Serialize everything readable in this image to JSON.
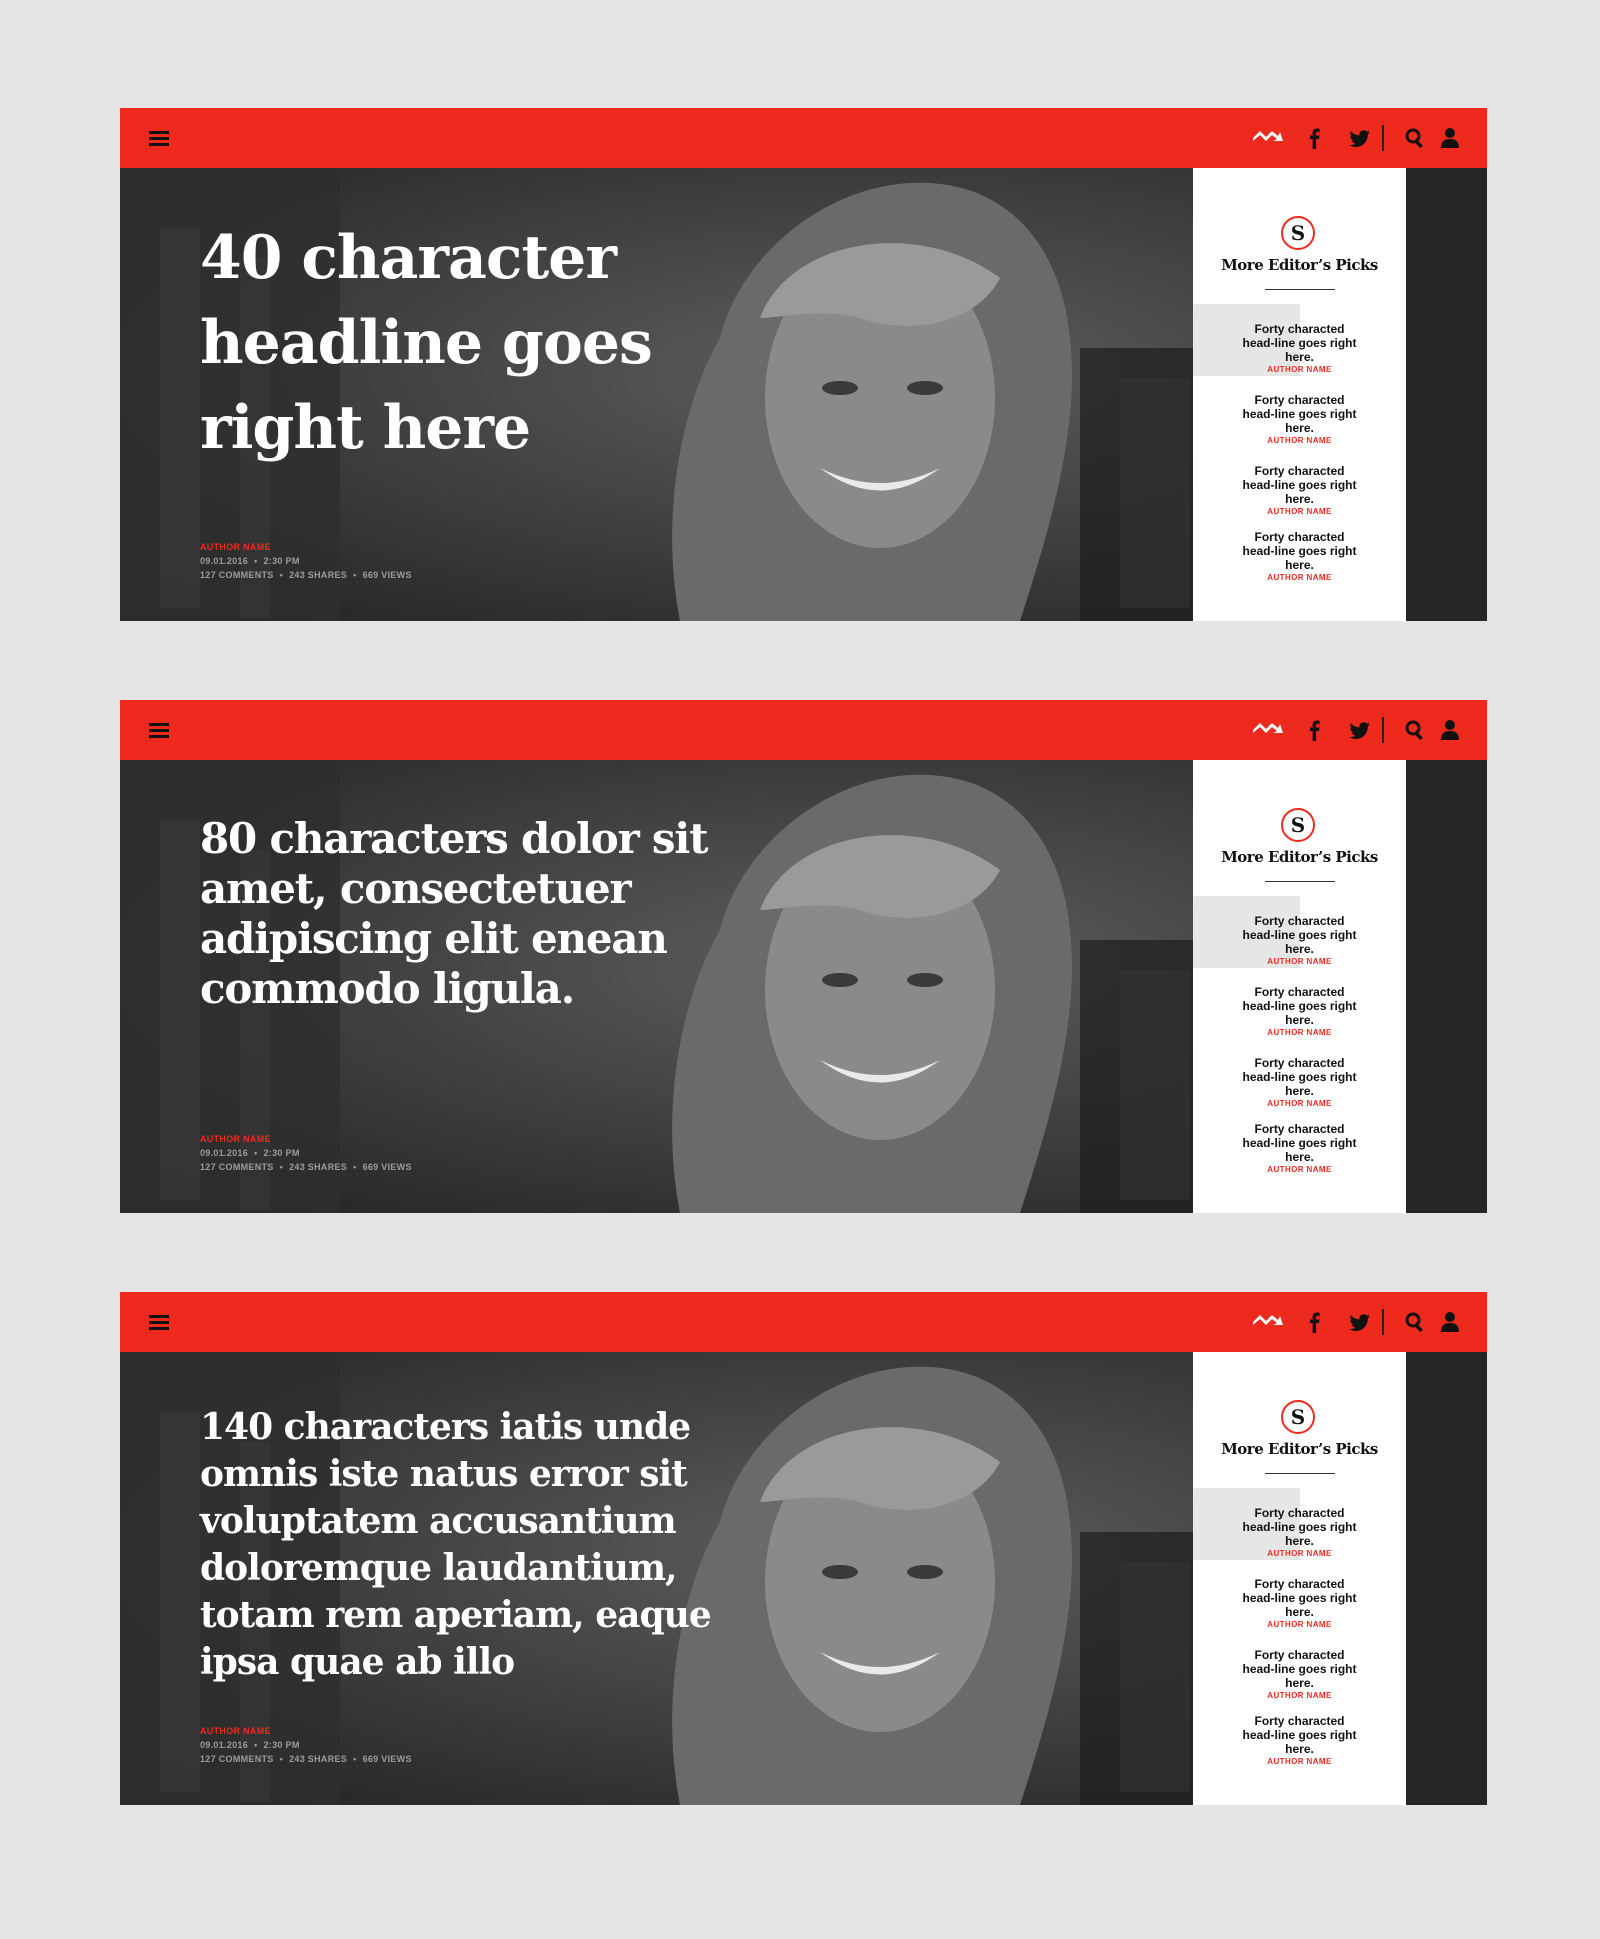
{
  "variants": [
    {
      "headline": "40 character headline goes right here",
      "author": "AUTHOR NAME",
      "date": "09.01.2016",
      "time": "2:30 PM",
      "comments": "127 COMMENTS",
      "shares": "243 SHARES",
      "views": "669 VIEWS"
    },
    {
      "headline": "80 characters dolor sit amet, consectetuer adipiscing elit enean commodo ligula.",
      "author": "AUTHOR NAME",
      "date": "09.01.2016",
      "time": "2:30 PM",
      "comments": "127 COMMENTS",
      "shares": "243 SHARES",
      "views": "669 VIEWS"
    },
    {
      "headline": "140 characters iatis unde omnis iste natus error sit voluptatem accusantium doloremque laudantium, totam rem aperiam, eaque ipsa quae ab illo",
      "author": "AUTHOR NAME",
      "date": "09.01.2016",
      "time": "2:30 PM",
      "comments": "127 COMMENTS",
      "shares": "243 SHARES",
      "views": "669 VIEWS"
    }
  ],
  "topbar": {
    "icons": [
      "menu-icon",
      "brand-icon",
      "facebook-icon",
      "twitter-icon",
      "search-icon",
      "user-icon"
    ]
  },
  "picks": {
    "logo_letter": "S",
    "title": "More Editor’s Picks",
    "items": [
      {
        "headline": "Forty characted head-line goes right here.",
        "author": "AUTHOR NAME"
      },
      {
        "headline": "Forty characted head-line goes right here.",
        "author": "AUTHOR NAME"
      },
      {
        "headline": "Forty characted head-line goes right here.",
        "author": "AUTHOR NAME"
      },
      {
        "headline": "Forty characted head-line goes right here.",
        "author": "AUTHOR NAME"
      }
    ]
  },
  "colors": {
    "accent": "#ee2a1e",
    "background": "#e5e5e5",
    "hero": "#2a2a2a"
  }
}
